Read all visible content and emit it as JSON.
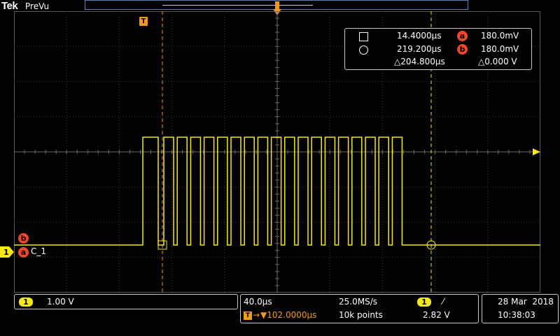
{
  "header": {
    "brand": "Tek",
    "status": "PreVu"
  },
  "trigger_marker": "T",
  "cursor_readout": {
    "square_time": "14.4000µs",
    "circle_time": "219.200µs",
    "delta_time": "△204.800µs",
    "label_a": "a",
    "value_a": "180.0mV",
    "label_b": "b",
    "value_b": "180.0mV",
    "delta_voltage": "△0.000 V"
  },
  "channel": {
    "number": "1",
    "label": "C_1",
    "cursor_a": "a",
    "cursor_b": "b",
    "scale": "1.00 V"
  },
  "horizontal": {
    "time_div": "40.0µs",
    "sample_rate": "25.0MS/s",
    "trigger_position": "▼102.0000µs",
    "record_length": "10k points"
  },
  "trigger": {
    "source": "1",
    "slope": "⁄",
    "level": "2.82 V"
  },
  "datetime": {
    "date": "28 Mar  2018",
    "time": "10:38:03"
  },
  "colors": {
    "trace": "#f5e90f",
    "trigger": "#f39a1d",
    "cursor_badge": "#f0462a",
    "grid": "#3a3a3a"
  },
  "waveform": {
    "pulse_count": 19,
    "idle_level_v": 0,
    "high_level_v": 2.82
  }
}
